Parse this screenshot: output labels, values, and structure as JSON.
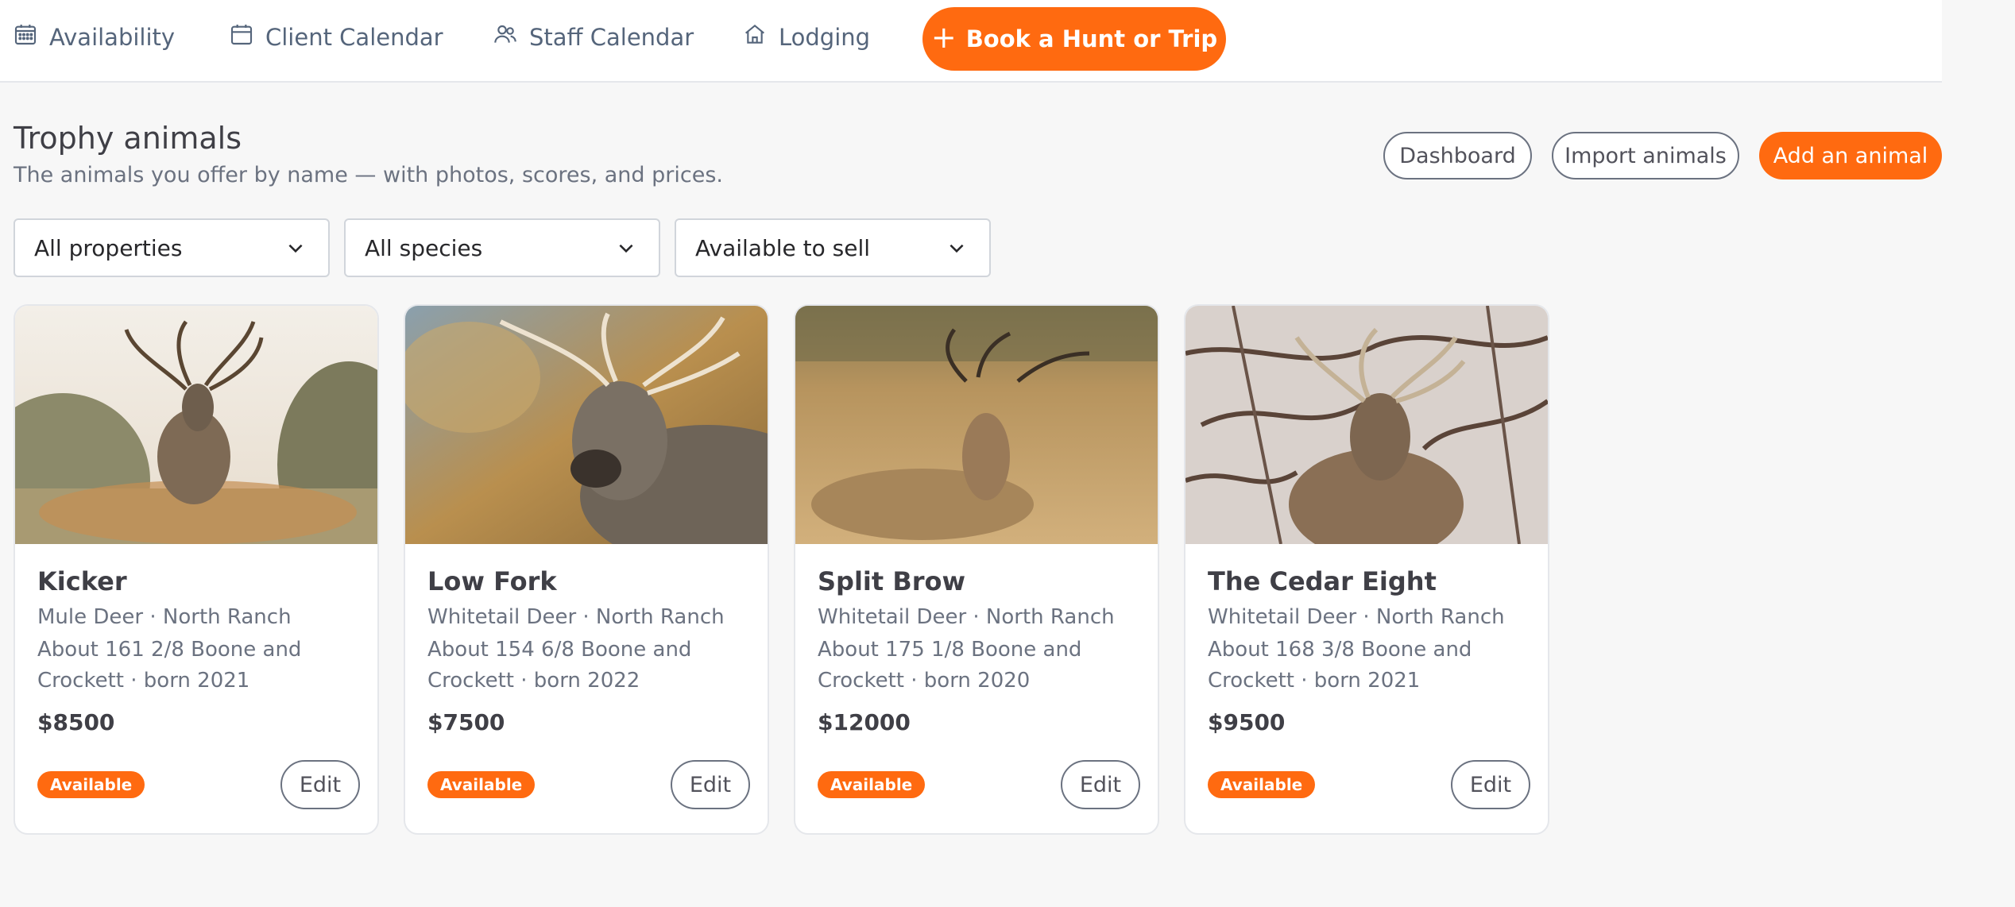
{
  "nav": {
    "items": [
      {
        "label": "Availability",
        "icon": "calendar-grid-icon"
      },
      {
        "label": "Client Calendar",
        "icon": "calendar-icon"
      },
      {
        "label": "Staff Calendar",
        "icon": "users-icon"
      },
      {
        "label": "Lodging",
        "icon": "home-icon"
      }
    ],
    "book_label": "Book a Hunt or Trip",
    "book_icon": "plus-icon"
  },
  "header": {
    "title": "Trophy animals",
    "subtitle": "The animals you offer by name — with photos, scores, and prices.",
    "dashboard_label": "Dashboard",
    "import_label": "Import animals",
    "add_label": "Add an animal"
  },
  "filters": {
    "property": "All properties",
    "species": "All species",
    "status": "Available to sell"
  },
  "animals": [
    {
      "name": "Kicker",
      "species_line": "Mule Deer · North Ranch",
      "desc": "About 161 2/8 Boone and Crockett · born 2021",
      "price": "$8500",
      "status": "Available",
      "edit_label": "Edit"
    },
    {
      "name": "Low Fork",
      "species_line": "Whitetail Deer · North Ranch",
      "desc": "About 154 6/8 Boone and Crockett · born 2022",
      "price": "$7500",
      "status": "Available",
      "edit_label": "Edit"
    },
    {
      "name": "Split Brow",
      "species_line": "Whitetail Deer · North Ranch",
      "desc": "About 175 1/8 Boone and Crockett · born 2020",
      "price": "$12000",
      "status": "Available",
      "edit_label": "Edit"
    },
    {
      "name": "The Cedar Eight",
      "species_line": "Whitetail Deer · North Ranch",
      "desc": "About 168 3/8 Boone and Crockett · born 2021",
      "price": "$9500",
      "status": "Available",
      "edit_label": "Edit"
    }
  ],
  "colors": {
    "accent": "#ff6a10",
    "nav_text": "#55657b"
  }
}
